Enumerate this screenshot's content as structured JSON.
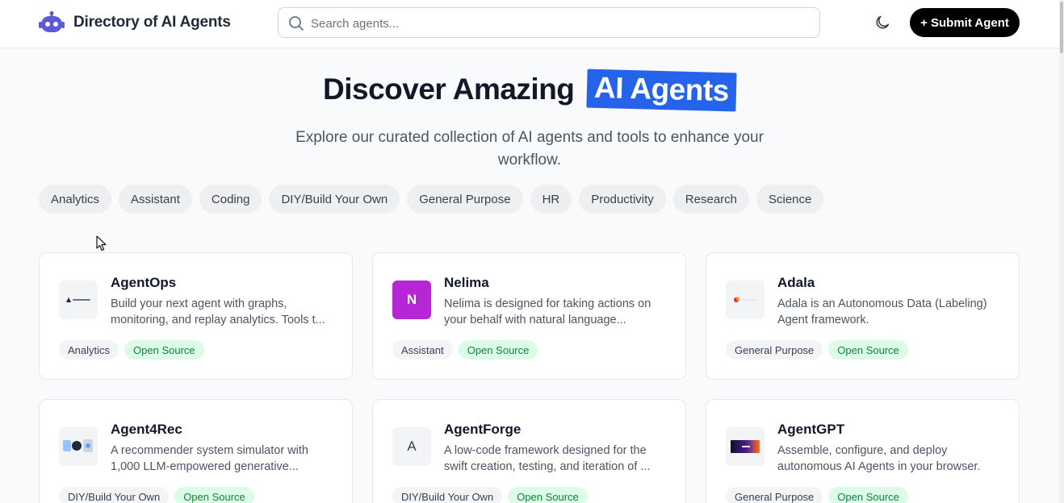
{
  "header": {
    "brand": "Directory of AI Agents",
    "search_placeholder": "Search agents...",
    "submit_label": "+ Submit Agent"
  },
  "hero": {
    "title_prefix": "Discover Amazing",
    "title_highlight": "AI Agents",
    "subtitle": "Explore our curated collection of AI agents and tools to enhance your workflow."
  },
  "categories": [
    "Analytics",
    "Assistant",
    "Coding",
    "DIY/Build Your Own",
    "General Purpose",
    "HR",
    "Productivity",
    "Research",
    "Science"
  ],
  "cards": [
    {
      "name": "AgentOps",
      "desc": "Build your next agent with graphs, monitoring, and replay analytics. Tools t...",
      "category": "Analytics",
      "badge": "Open Source",
      "thumb": "AgentOps"
    },
    {
      "name": "Nelima",
      "desc": "Nelima is designed for taking actions on your behalf with natural language...",
      "category": "Assistant",
      "badge": "Open Source",
      "thumb": "N"
    },
    {
      "name": "Adala",
      "desc": "Adala is an Autonomous Data (Labeling) Agent framework.",
      "category": "General Purpose",
      "badge": "Open Source",
      "thumb": ""
    },
    {
      "name": "Agent4Rec",
      "desc": "A recommender system simulator with 1,000 LLM-empowered generative...",
      "category": "DIY/Build Your Own",
      "badge": "Open Source",
      "thumb": ""
    },
    {
      "name": "AgentForge",
      "desc": "A low-code framework designed for the swift creation, testing, and iteration of ...",
      "category": "DIY/Build Your Own",
      "badge": "Open Source",
      "thumb": "A"
    },
    {
      "name": "AgentGPT",
      "desc": "Assemble, configure, and deploy autonomous AI Agents in your browser.",
      "category": "General Purpose",
      "badge": "Open Source",
      "thumb": ""
    }
  ],
  "colors": {
    "accent": "#2563eb",
    "nelima": "#b626d6",
    "open_source_bg": "#dcfce7",
    "open_source_text": "#15803d"
  }
}
